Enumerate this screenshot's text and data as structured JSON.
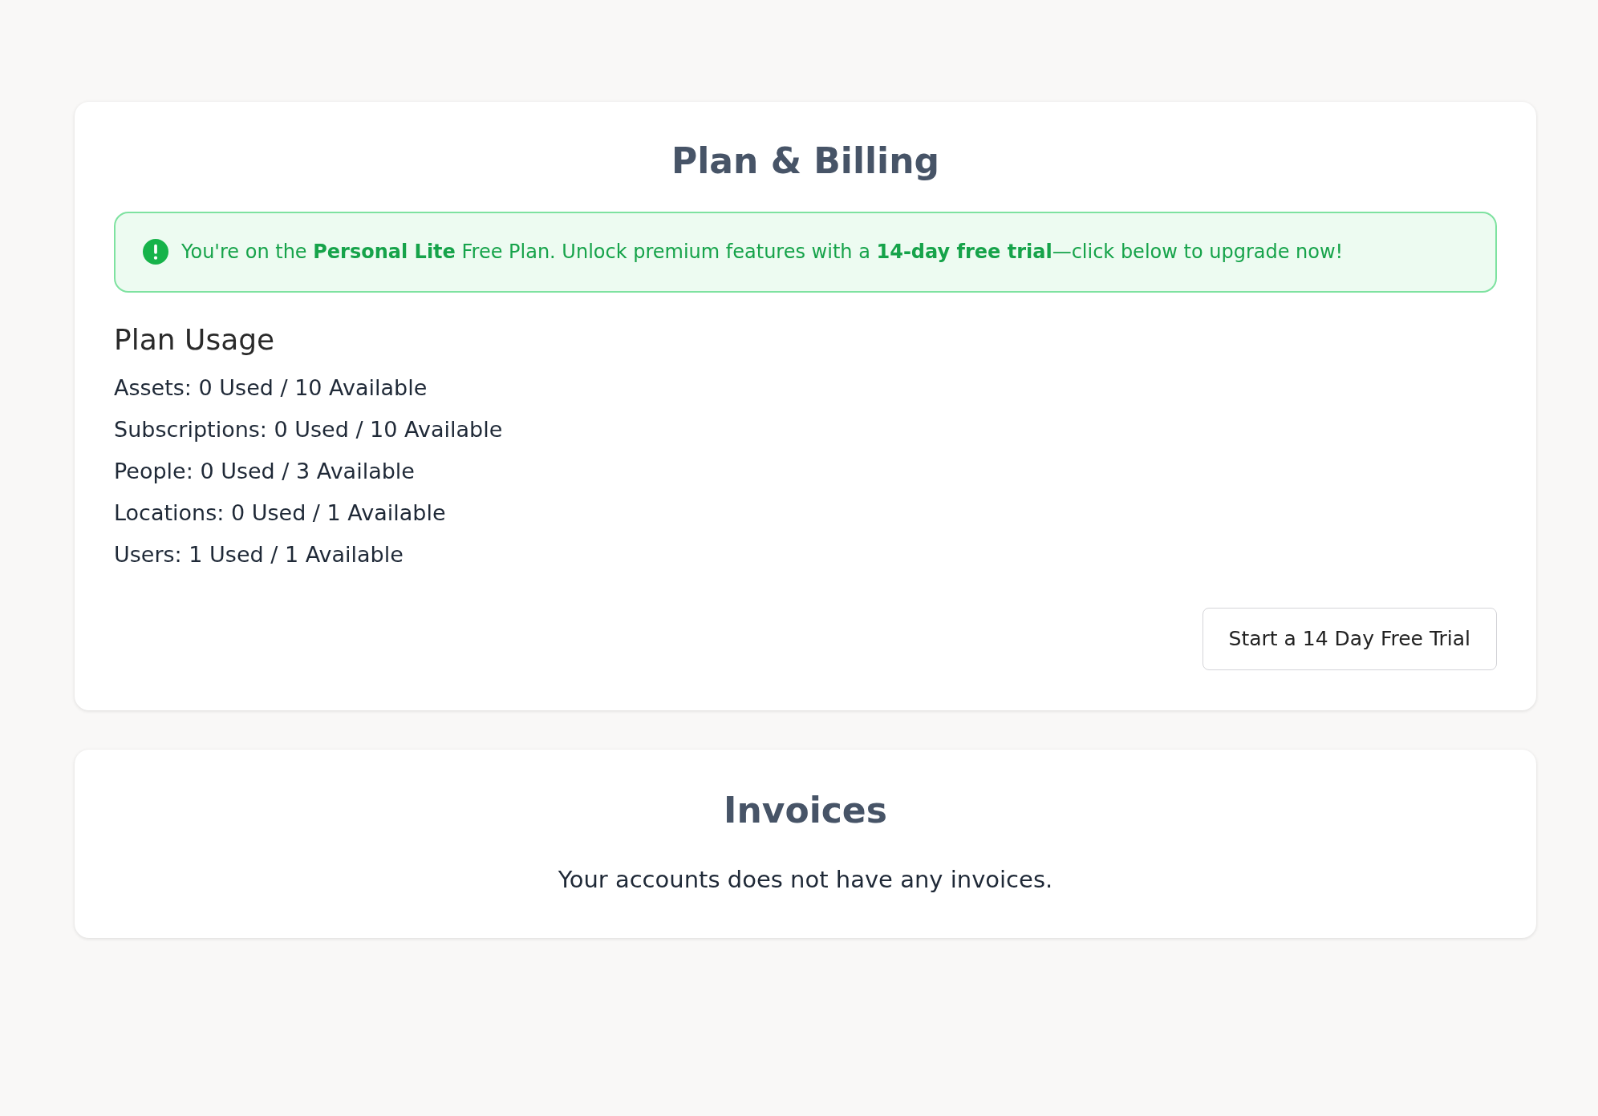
{
  "plan_billing": {
    "title": "Plan & Billing",
    "alert": {
      "text": "You're on the **Personal Lite** Free Plan. Unlock premium features with a **14-day free trial**—click below to upgrade now!"
    },
    "usage": {
      "heading": "Plan Usage",
      "lines": [
        "Assets: 0 Used / 10 Available",
        "Subscriptions: 0 Used / 10 Available",
        "People: 0 Used / 3 Available",
        "Locations: 0 Used / 1 Available",
        "Users: 1 Used / 1 Available"
      ]
    },
    "button": "Start a 14 Day Free Trial"
  },
  "invoices": {
    "title": "Invoices",
    "message": "Your accounts does not have any invoices."
  }
}
